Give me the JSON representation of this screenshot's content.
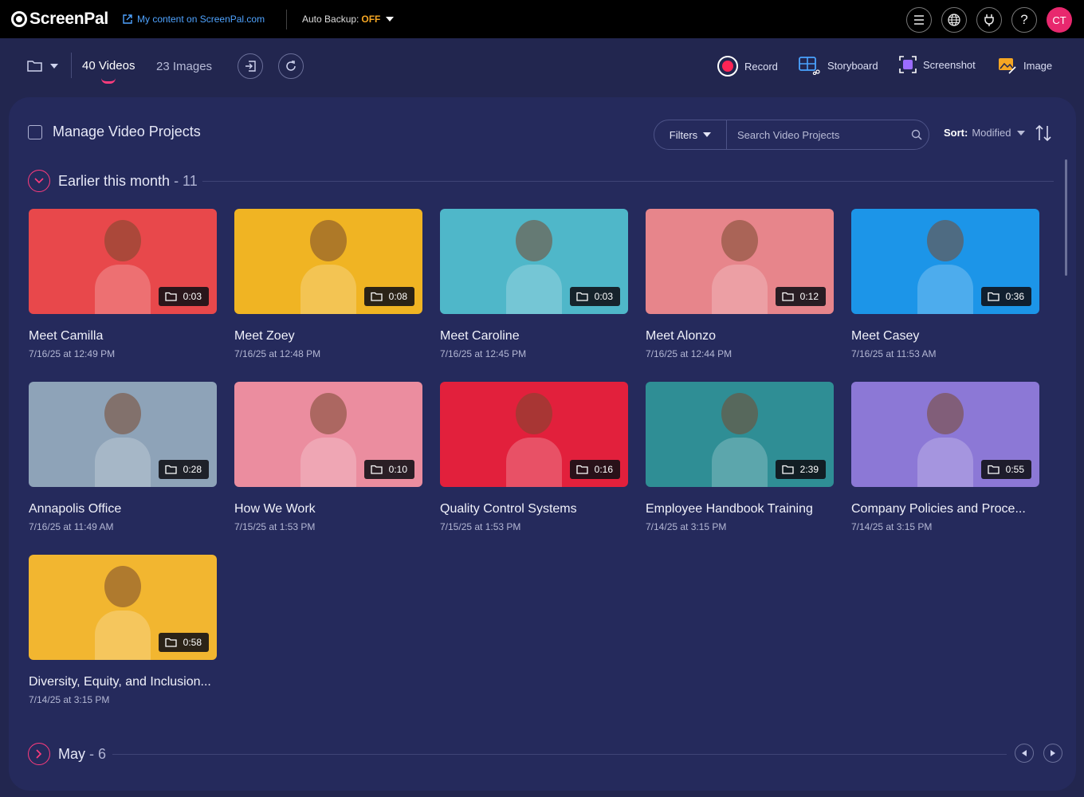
{
  "topbar": {
    "brand": "ScreenPal",
    "my_content_prefix": "My content on ",
    "my_content_site": "ScreenPal.com",
    "auto_backup_label": "Auto Backup: ",
    "auto_backup_value": "OFF",
    "avatar_initials": "CT",
    "icons": [
      "menu-icon",
      "globe-icon",
      "plug-icon",
      "help-icon"
    ]
  },
  "toolbar": {
    "videos_tab": "40 Videos",
    "images_tab": "23 Images",
    "record": "Record",
    "storyboard": "Storyboard",
    "screenshot": "Screenshot",
    "image": "Image"
  },
  "panel": {
    "manage_label": "Manage Video Projects",
    "filters_label": "Filters",
    "search_placeholder": "Search Video Projects",
    "sort_label": "Sort:",
    "sort_value": "Modified"
  },
  "sections": [
    {
      "title": "Earlier this month",
      "count": " - 11",
      "expanded": true
    },
    {
      "title": "May",
      "count": " - 6",
      "expanded": false
    }
  ],
  "videos": [
    {
      "title": "Meet Camilla",
      "date": "7/16/25 at 12:49 PM",
      "duration": "0:03",
      "bg": "#e8484b"
    },
    {
      "title": "Meet Zoey",
      "date": "7/16/25 at 12:48 PM",
      "duration": "0:08",
      "bg": "#f0b423"
    },
    {
      "title": "Meet Caroline",
      "date": "7/16/25 at 12:45 PM",
      "duration": "0:03",
      "bg": "#4fb7c9"
    },
    {
      "title": "Meet Alonzo",
      "date": "7/16/25 at 12:44 PM",
      "duration": "0:12",
      "bg": "#e7858b"
    },
    {
      "title": "Meet Casey",
      "date": "7/16/25 at 11:53 AM",
      "duration": "0:36",
      "bg": "#1c95e8"
    },
    {
      "title": "Annapolis Office",
      "date": "7/16/25 at 11:49 AM",
      "duration": "0:28",
      "bg": "#8ea3b8"
    },
    {
      "title": "How We Work",
      "date": "7/15/25 at 1:53 PM",
      "duration": "0:10",
      "bg": "#eb8d9f"
    },
    {
      "title": "Quality Control Systems",
      "date": "7/15/25 at 1:53 PM",
      "duration": "0:16",
      "bg": "#e2203c"
    },
    {
      "title": "Employee Handbook Training",
      "date": "7/14/25 at 3:15 PM",
      "duration": "2:39",
      "bg": "#2f8e95"
    },
    {
      "title": "Company Policies and Proce...",
      "date": "7/14/25 at 3:15 PM",
      "duration": "0:55",
      "bg": "#8c78d6"
    },
    {
      "title": "Diversity, Equity, and Inclusion...",
      "date": "7/14/25 at 3:15 PM",
      "duration": "0:58",
      "bg": "#f2b630"
    }
  ]
}
